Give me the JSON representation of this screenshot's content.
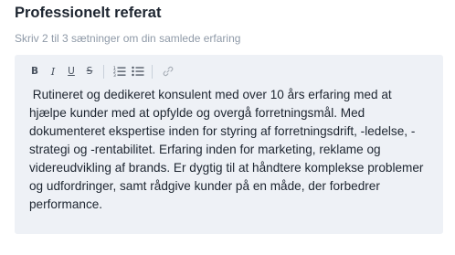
{
  "section": {
    "title": "Professionelt referat",
    "hint": "Skriv 2 til 3 sætninger om din samlede erfaring"
  },
  "toolbar": {
    "bold_label": "B",
    "italic_label": "I",
    "underline_label": "U",
    "strike_label": "S",
    "icons": [
      "bold-icon",
      "italic-icon",
      "underline-icon",
      "strikethrough-icon",
      "ordered-list-icon",
      "bullet-list-icon",
      "link-icon"
    ]
  },
  "editor": {
    "background": "#eef1f6",
    "text": " Rutineret og dedikeret konsulent med over 10 års erfaring med at hjælpe kunder med at opfylde og overgå forretningsmål. Med dokumenteret ekspertise inden for styring af forretningsdrift, -ledelse, -strategi og -rentabilitet. Erfaring inden for marketing, reklame og videreudvikling af brands. Er dygtig til at håndtere komplekse problemer og udfordringer, samt rådgive kunder på en måde, der forbedrer performance."
  }
}
